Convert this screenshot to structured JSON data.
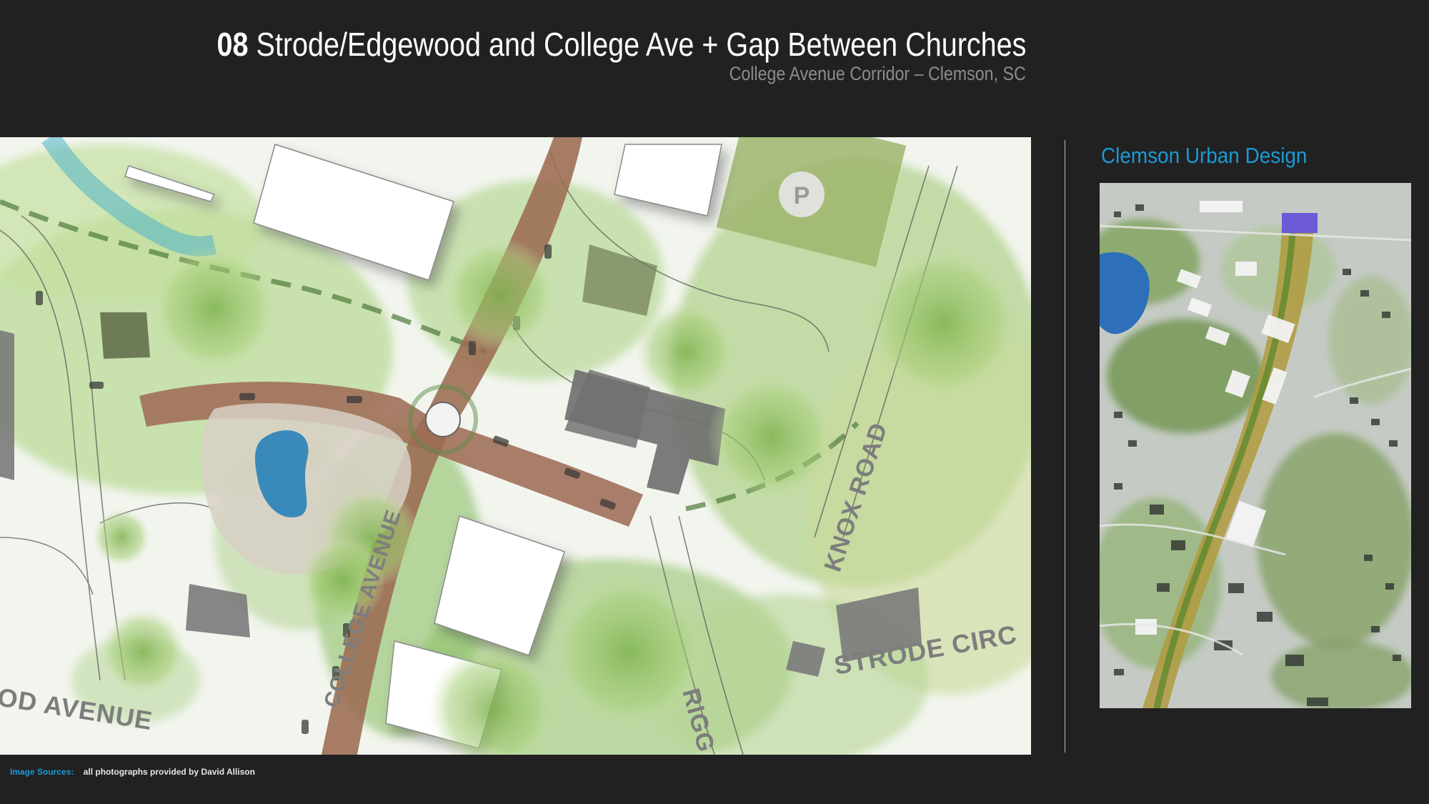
{
  "header": {
    "title_number": "08",
    "title_text": "Strode/Edgewood and College Ave + Gap Between Churches",
    "subtitle": "College Avenue Corridor – Clemson, SC"
  },
  "plan": {
    "street_labels": {
      "knox": "KNOX ROAD",
      "strode": "STRODE CIRC",
      "college": "COLLEGE AVENUE",
      "edgewood": "OD AVENUE",
      "riggs": "RIGG"
    },
    "parking_symbol": "P"
  },
  "sidebar": {
    "title": "Clemson Urban Design"
  },
  "footer": {
    "sources_label": "Image Sources:",
    "sources_text": "all photographs provided by David Allison"
  },
  "colors": {
    "background": "#212121",
    "accent_blue": "#1a9ad6",
    "road_brick": "#9a6a52",
    "vegetation": "#8fc06a",
    "water": "#2f86b8"
  }
}
